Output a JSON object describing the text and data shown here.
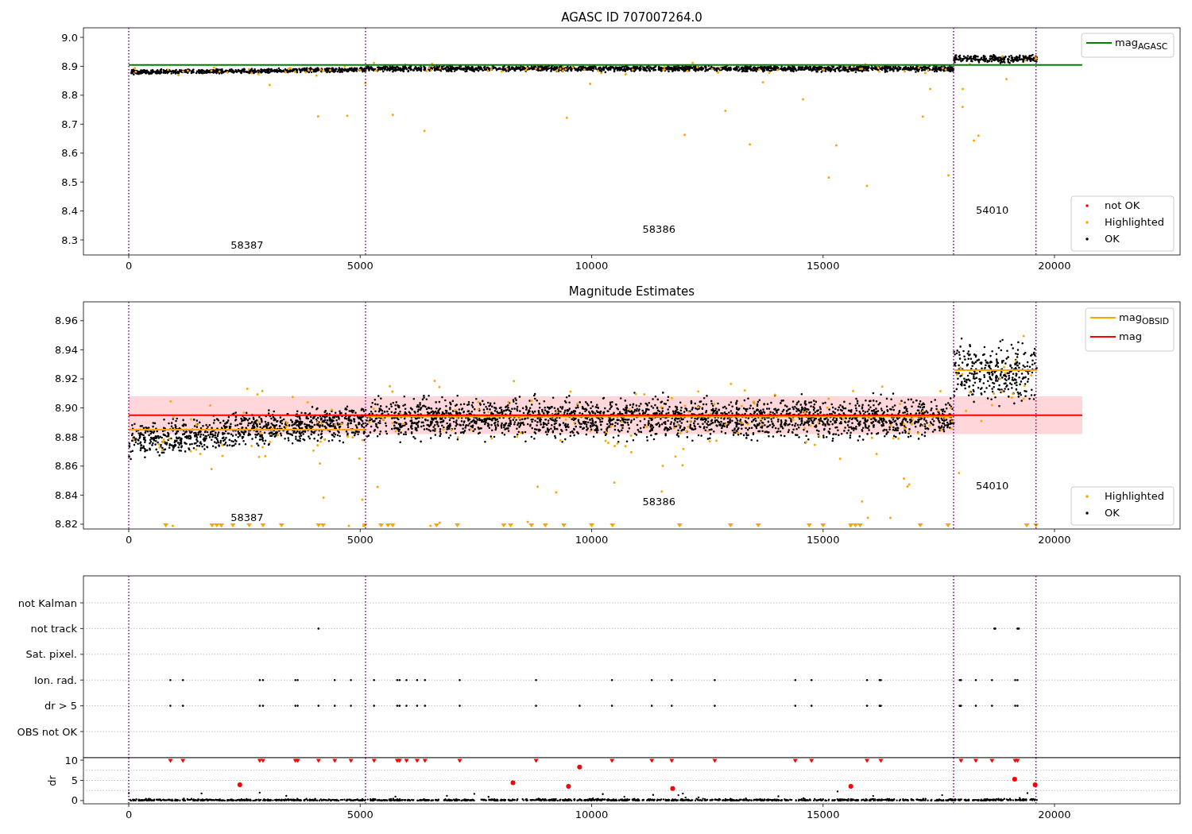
{
  "panels": [
    {
      "title": "AGASC ID 707007264.0",
      "chart_data": {
        "type": "scatter",
        "xlim": [
          -979,
          22713
        ],
        "ylim": [
          8.248,
          9.033
        ],
        "xticks": [
          0,
          5000,
          10000,
          15000,
          20000
        ],
        "yticks": [
          {
            "value": 8.3,
            "label": "8.3"
          },
          {
            "value": 8.4,
            "label": "8.4"
          },
          {
            "value": 8.5,
            "label": "8.5"
          },
          {
            "value": 8.6,
            "label": "8.6"
          },
          {
            "value": 8.7,
            "label": "8.7"
          },
          {
            "value": 8.8,
            "label": "8.8"
          },
          {
            "value": 8.9,
            "label": "8.9"
          },
          {
            "value": 9.0,
            "label": "9.0"
          }
        ],
        "ref_lines": [
          {
            "axis": "y",
            "value": 8.905,
            "color": "#008000",
            "label": "mag$_{AGASC}$"
          },
          {
            "axis": "x",
            "value": 0,
            "color": "#800080"
          },
          {
            "axis": "x",
            "value": 5116,
            "color": "#800080"
          },
          {
            "axis": "x",
            "value": 17820,
            "color": "#800080"
          },
          {
            "axis": "x",
            "value": 19600,
            "color": "#800080"
          }
        ],
        "legend": "upper right",
        "annotations": [
          "58387",
          "58386",
          "54010"
        ]
      },
      "legend": [
        {
          "label": "not OK",
          "color": "#ff0000"
        },
        {
          "label": "Highlighted",
          "color": "#ffa500"
        },
        {
          "label": "OK",
          "color": "#000000"
        }
      ]
    },
    {
      "title": "Magnitude Estimates",
      "chart_data": {
        "type": "line",
        "xlim": [
          -979,
          22713
        ],
        "ylim": [
          8.8167,
          8.973
        ],
        "xticks": [
          0,
          5000,
          10000,
          15000,
          20000
        ],
        "yticks": [
          {
            "value": 8.82,
            "label": "8.82"
          },
          {
            "value": 8.84,
            "label": "8.84"
          },
          {
            "value": 8.86,
            "label": "8.86"
          },
          {
            "value": 8.88,
            "label": "8.88"
          },
          {
            "value": 8.9,
            "label": "8.90"
          },
          {
            "value": 8.92,
            "label": "8.92"
          },
          {
            "value": 8.94,
            "label": "8.94"
          },
          {
            "value": 8.96,
            "label": "8.96"
          }
        ],
        "x": [
          0,
          5110,
          5115,
          5120,
          17830,
          17835,
          17840,
          19620
        ],
        "series": [
          {
            "name": "mag$_{OBSID}$",
            "color": "#ffa500",
            "values": [
              8.885,
              8.885,
              null,
              8.894,
              8.894,
              null,
              8.926,
              8.926
            ]
          }
        ],
        "ref_lines": [
          {
            "axis": "y",
            "value": 8.895,
            "color": "#ff0000",
            "label": "mag"
          },
          {
            "axis": "x",
            "value": 0,
            "color": "#800080"
          },
          {
            "axis": "x",
            "value": 5116,
            "color": "#800080"
          },
          {
            "axis": "x",
            "value": 17820,
            "color": "#800080"
          },
          {
            "axis": "x",
            "value": 19600,
            "color": "#800080"
          }
        ],
        "bands": [
          {
            "axis": "y",
            "from": 8.882,
            "to": 8.908,
            "color": "#ffd6d9"
          }
        ],
        "legend": "upper right",
        "annotations": [
          "58387",
          "58386",
          "54010"
        ]
      },
      "legend": [
        {
          "label": "Highlighted",
          "color": "#ffa500"
        },
        {
          "label": "OK",
          "color": "#000000"
        }
      ]
    }
  ],
  "flags": {
    "rows": [
      "not Kalman",
      "not track",
      "Sat. pixel.",
      "Ion. rad.",
      "dr > 5",
      "OBS not OK"
    ],
    "chart_data": {
      "type": "scatter",
      "ylabel": "dr",
      "xlim": [
        -979,
        22713
      ],
      "ylim": [
        -0.8,
        10.6
      ],
      "xticks": [
        0,
        5000,
        10000,
        15000,
        20000
      ],
      "yticks": [
        0,
        5,
        10
      ],
      "x": [
        900,
        1170,
        2400,
        2830,
        2900,
        3600,
        3650,
        4100,
        4450,
        4800,
        5300,
        5800,
        5850,
        6000,
        6230,
        6400,
        7150,
        8300,
        8800,
        9500,
        9740,
        10440,
        11300,
        11730,
        11750,
        12660,
        14400,
        14750,
        15600,
        15950,
        16220,
        16250,
        17950,
        17980,
        18300,
        18650,
        19140,
        19150,
        19200,
        19580
      ],
      "series": [
        {
          "color": "#ff0000",
          "values": [
            9.8,
            9.8,
            null,
            9.8,
            9.8,
            9.8,
            9.8,
            9.8,
            9.8,
            9.8,
            9.8,
            9.8,
            9.8,
            9.8,
            9.8,
            9.8,
            9.8,
            null,
            9.8,
            null,
            null,
            9.8,
            9.8,
            9.8,
            null,
            9.8,
            9.8,
            9.8,
            null,
            9.8,
            null,
            9.8,
            null,
            9.8,
            9.8,
            9.8,
            null,
            9.8,
            9.8,
            null
          ]
        },
        {
          "color": "#ff0000",
          "values": [
            null,
            null,
            3.9,
            null,
            null,
            null,
            null,
            null,
            null,
            null,
            null,
            null,
            null,
            null,
            null,
            null,
            null,
            4.4,
            null,
            3.5,
            8.3,
            null,
            null,
            null,
            3.0,
            null,
            null,
            null,
            3.5,
            null,
            null,
            null,
            null,
            null,
            null,
            null,
            5.3,
            null,
            null,
            3.9
          ]
        }
      ],
      "ref_lines": [
        {
          "axis": "x",
          "value": 0,
          "color": "#800080"
        },
        {
          "axis": "x",
          "value": 5116,
          "color": "#800080"
        },
        {
          "axis": "x",
          "value": 17820,
          "color": "#800080"
        },
        {
          "axis": "x",
          "value": 19600,
          "color": "#800080"
        }
      ]
    }
  }
}
